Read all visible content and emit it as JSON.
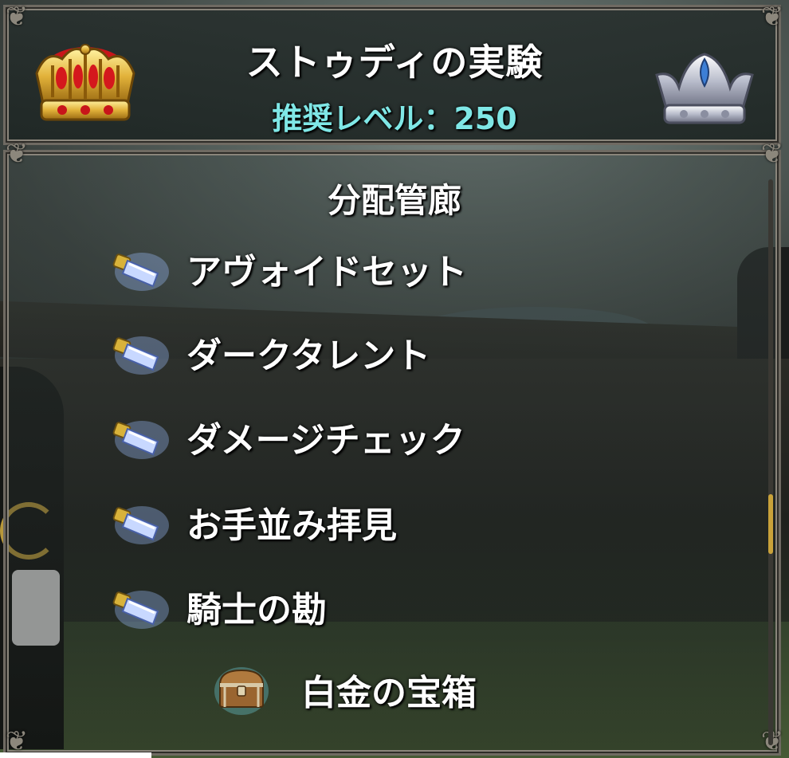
{
  "header": {
    "title": "ストゥディの実験",
    "recommended_level": "推奨レベル：250"
  },
  "panel": {
    "section_title": "分配管廊",
    "items": [
      {
        "label": "アヴォイドセット",
        "icon": "crystal-key-icon"
      },
      {
        "label": "ダークタレント",
        "icon": "crystal-key-icon"
      },
      {
        "label": "ダメージチェック",
        "icon": "crystal-key-icon"
      },
      {
        "label": "お手並み拝見",
        "icon": "crystal-key-icon"
      },
      {
        "label": "騎士の勘",
        "icon": "crystal-key-icon"
      }
    ],
    "reward": {
      "label": "白金の宝箱",
      "icon": "treasure-chest-icon"
    }
  },
  "colors": {
    "level_text": "#7fe7e6",
    "frame": "#6f6a62",
    "scroll_thumb": "#c9a23a"
  }
}
